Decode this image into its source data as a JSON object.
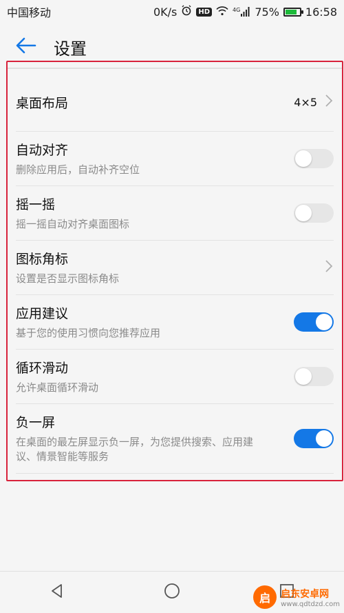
{
  "status_bar": {
    "carrier": "中国移动",
    "net_speed": "0K/s",
    "hd_badge": "HD",
    "signal_tag": "4G",
    "battery": "75%",
    "battery_level": 0.75,
    "time": "16:58"
  },
  "header": {
    "back_icon": "arrow-left-icon",
    "title": "设置"
  },
  "settings": {
    "desktop_layout": {
      "title": "桌面布局",
      "value": "4×5"
    },
    "auto_align": {
      "title": "自动对齐",
      "subtitle": "删除应用后，自动补齐空位",
      "on": false
    },
    "shake": {
      "title": "摇一摇",
      "subtitle": "摇一摇自动对齐桌面图标",
      "on": false
    },
    "icon_badge": {
      "title": "图标角标",
      "subtitle": "设置是否显示图标角标"
    },
    "app_suggestion": {
      "title": "应用建议",
      "subtitle": "基于您的使用习惯向您推荐应用",
      "on": true
    },
    "loop_scroll": {
      "title": "循环滑动",
      "subtitle": "允许桌面循环滑动",
      "on": false
    },
    "minus_one_screen": {
      "title": "负一屏",
      "subtitle": "在桌面的最左屏显示负一屏，为您提供搜索、应用建议、情景智能等服务",
      "on": true
    }
  },
  "watermark": {
    "title": "启东安卓网",
    "url": "www.qdtdzd.com"
  },
  "colors": {
    "accent": "#1478e6",
    "highlight_border": "#d8223b",
    "toggle_off": "#e6e6e6",
    "background": "#f5f5f5"
  }
}
